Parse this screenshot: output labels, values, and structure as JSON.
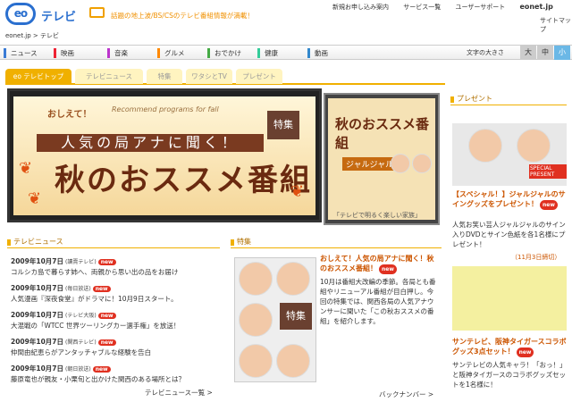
{
  "header": {
    "logo": "eo",
    "title": "テレビ",
    "tagline": "話題の地上波/BS/CSのテレビ番組情報が満載！",
    "links": [
      "新規お申し込み案内",
      "サービス一覧",
      "ユーザーサポート"
    ],
    "site": "eonet.jp",
    "sitemap": "サイトマップ"
  },
  "breadcrumb": "eonet.jp > テレビ",
  "nav": {
    "items": [
      "ニュース",
      "映画",
      "音楽",
      "グルメ",
      "おでかけ",
      "健康",
      "動画"
    ],
    "font_size_label": "文字の大きさ",
    "sizes": [
      "大",
      "中",
      "小"
    ]
  },
  "tabs": [
    "eo テレビトップ",
    "テレビニュース",
    "特集",
    "ワタシとTV",
    "プレゼント"
  ],
  "banner": {
    "recommend": "Recommend programs for fall",
    "oshiete": "おしえて！",
    "band": "人気の局アナに聞く！",
    "big": "秋のおススメ番組",
    "tokusyu": "特集"
  },
  "thumb": {
    "t1": "秋のおススメ番組",
    "t2": "ジャルジャル",
    "t3": "「テレビで明るく楽しい家族」"
  },
  "news": {
    "title": "テレビニュース",
    "items": [
      {
        "date": "2009年10月7日",
        "src": "(讀賣テレビ)",
        "text": "コルシカ島で暮らす姉へ、両親から思い出の品をお届け"
      },
      {
        "date": "2009年10月7日",
        "src": "(毎日放送)",
        "text": "人気漫画『深夜食堂』がドラマに！10月9日スタート。"
      },
      {
        "date": "2009年10月7日",
        "src": "(テレビ大阪)",
        "text": "大混戦の「WTCC 世界ツーリングカー選手権」を放送！"
      },
      {
        "date": "2009年10月7日",
        "src": "(関西テレビ)",
        "text": "仲間由紀恵らがアンタッチャブルな経験を告白"
      },
      {
        "date": "2009年10月7日",
        "src": "(朝日放送)",
        "text": "藤原竜也が親友・小栗旬と出かけた関西のある場所とは？"
      }
    ],
    "badge": "new",
    "more": "テレビニュース一覧 >"
  },
  "feature": {
    "title": "特集",
    "tokusyu": "特集",
    "headline": "おしえて！人気の局アナに聞く！秋のおススメ番組！",
    "badge": "new",
    "body": "10月は番組大改編の季節。各局とも番組やリニューアル番組が目白押し。今回の特集では、関西各局の人気アナウンサーに聞いた「この秋おススメの番組」を紹介します。",
    "more": "バックナンバー >"
  },
  "present": {
    "title": "プレゼント",
    "p1_ttl": "【スペシャル！】ジャルジャルのサイングッズをプレゼント！",
    "p1_txt": "人気お笑い芸人ジャルジャルのサイン入りDVDとサイン色紙を各1名様にプレゼント！",
    "deadline": "（11月3日締切）",
    "p2_ttl": "サンテレビ、阪神タイガースコラボグッズ3点セット！",
    "p2_txt": "サンテレビの人気キャラ！「おっ！」と阪神タイガースのコラボグッズセットを1名様に！",
    "badge": "new",
    "sp": "SPECIAL PRESENT"
  }
}
